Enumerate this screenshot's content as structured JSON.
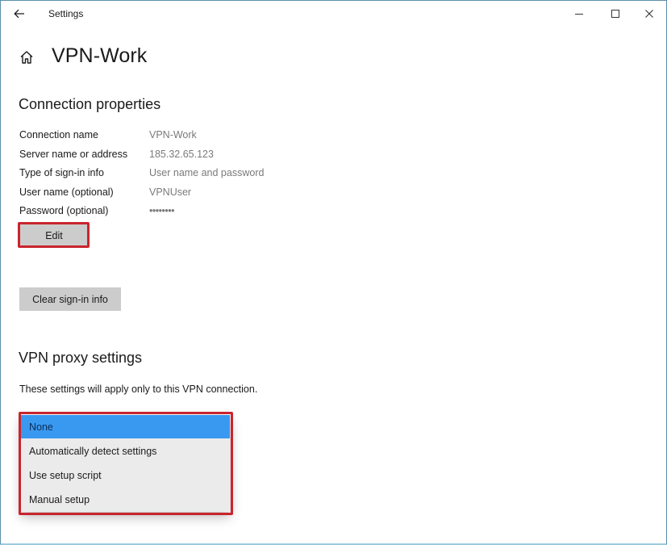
{
  "window": {
    "title": "Settings",
    "controls": {
      "back_icon": "arrow-left-icon",
      "minimize_icon": "minimize-icon",
      "maximize_icon": "maximize-icon",
      "close_icon": "close-icon"
    }
  },
  "header": {
    "home_icon": "home-icon",
    "title": "VPN-Work"
  },
  "connection_properties": {
    "title": "Connection properties",
    "rows": [
      {
        "label": "Connection name",
        "value": "VPN-Work"
      },
      {
        "label": "Server name or address",
        "value": "185.32.65.123"
      },
      {
        "label": "Type of sign-in info",
        "value": "User name and password"
      },
      {
        "label": "User name (optional)",
        "value": "VPNUser"
      },
      {
        "label": "Password (optional)",
        "value": "••••••••"
      }
    ],
    "edit_label": "Edit",
    "clear_label": "Clear sign-in info"
  },
  "proxy": {
    "title": "VPN proxy settings",
    "description": "These settings will apply only to this VPN connection.",
    "selected": "None",
    "options": [
      {
        "label": "None",
        "selected": true
      },
      {
        "label": "Automatically detect settings",
        "selected": false
      },
      {
        "label": "Use setup script",
        "selected": false
      },
      {
        "label": "Manual setup",
        "selected": false
      }
    ]
  },
  "annotations": {
    "highlight_color": "#c9252d",
    "accent_color": "#3999f1"
  }
}
